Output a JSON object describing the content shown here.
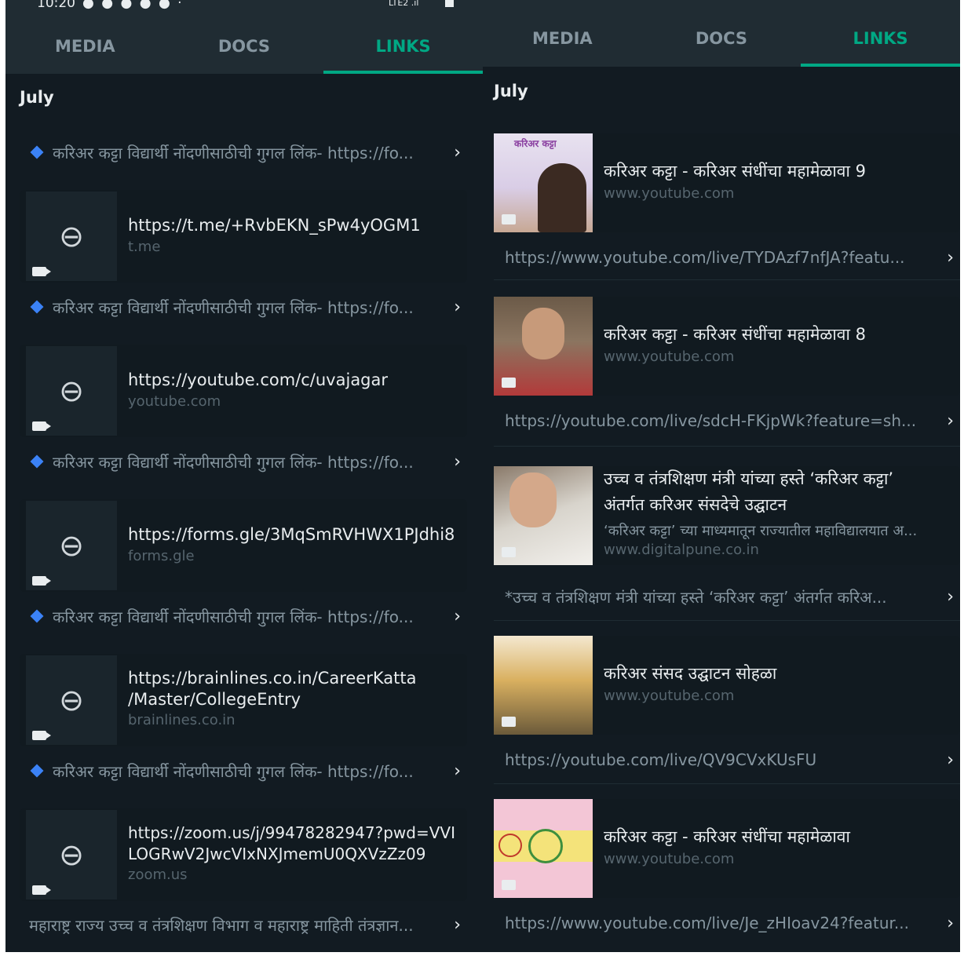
{
  "left": {
    "status": {
      "time": "10:20",
      "dots": "● ● ● ● ● ·",
      "network": "LTE2 .ıl"
    },
    "tabs": [
      "MEDIA",
      "DOCS",
      "LINKS"
    ],
    "month": "July",
    "message": "करिअर कट्टा विद्यार्थी नोंदणीसाठीची गुगल लिंक- https://fo...",
    "links": [
      {
        "title": "https://t.me/+RvbEKN_sPw4yOGM1",
        "domain": "t.me"
      },
      {
        "title": "https://youtube.com/c/uvajagar",
        "domain": "youtube.com"
      },
      {
        "title": "https://forms.gle/3MqSmRVHWX1PJdhi8",
        "domain": "forms.gle"
      },
      {
        "title": "https://brainlines.co.in/CareerKatta\n/Master/CollegeEntry",
        "title_line1": "https://brainlines.co.in/CareerKatta",
        "title_line2": "/Master/CollegeEntry",
        "domain": "brainlines.co.in"
      },
      {
        "title_line1": "https://zoom.us/j/99478282947?pwd=VVI",
        "title_line2": "LOGRwV2JwcVIxNXJmemU0QXVzZz09",
        "domain": "zoom.us"
      }
    ],
    "last_message": "महाराष्ट्र राज्य उच्च व तंत्रशिक्षण विभाग व महाराष्ट्र माहिती तंत्रज्ञान..."
  },
  "right": {
    "tabs": [
      "MEDIA",
      "DOCS",
      "LINKS"
    ],
    "month": "July",
    "items": [
      {
        "title": "करिअर कट्टा - करिअर संधींचा महामेळावा 9",
        "domain": "www.youtube.com",
        "url": "https://www.youtube.com/live/TYDAzf7nfJA?featu...",
        "thumb_label": "करिअर कट्टा"
      },
      {
        "title": "करिअर कट्टा - करिअर संधींचा महामेळावा 8",
        "domain": "www.youtube.com",
        "url": "https://youtube.com/live/sdcH-FKjpWk?feature=sh..."
      },
      {
        "title_line1": "उच्च व तंत्रशिक्षण मंत्री यांच्या हस्ते ‘करिअर कट्टा’",
        "title_line2": "अंतर्गत करिअर संसदेचे उद्घाटन",
        "desc": "‘करिअर कट्टा’ च्या माध्यमातून राज्यातील महाविद्यालयात अ...",
        "domain": "www.digitalpune.co.in",
        "url": "*उच्च व तंत्रशिक्षण मंत्री यांच्या हस्ते ‘करिअर कट्टा’ अंतर्गत करिअ..."
      },
      {
        "title": "करिअर संसद उद्घाटन सोहळा",
        "domain": "www.youtube.com",
        "url": "https://youtube.com/live/QV9CVxKUsFU"
      },
      {
        "title": "करिअर कट्टा - करिअर संधींचा महामेळावा",
        "domain": "www.youtube.com",
        "url": "https://www.youtube.com/live/Je_zHIoav24?featur..."
      }
    ]
  },
  "colors": {
    "accent": "#00a884",
    "background": "#121b22",
    "tabbar": "#202c33"
  }
}
